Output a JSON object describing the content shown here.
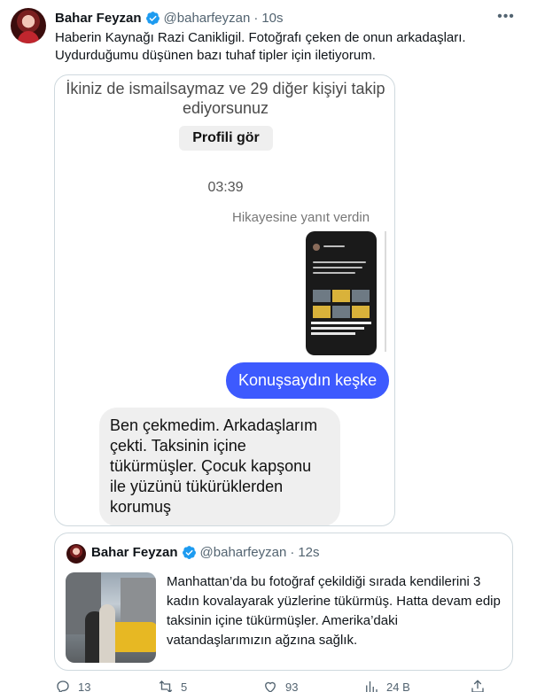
{
  "author": {
    "name": "Bahar Feyzan",
    "handle": "@baharfeyzan",
    "separator": "·",
    "time": "10s"
  },
  "tweet": {
    "text": "Haberin Kaynağı Razi Canikligil. Fotoğrafı çeken de onun arkadaşları. Uydurduğumu düşünen bazı tuhaf tipler için iletiyorum."
  },
  "dm": {
    "follow_notice": "İkiniz de ismailsaymaz ve 29 diğer kişiyi takip ediyorsunuz",
    "profile_button": "Profili gör",
    "time": "03:39",
    "story_reply_label": "Hikayesine yanıt verdin",
    "sent_message": "Konuşsaydın keşke",
    "received_message": "Ben çekmedim. Arkadaşlarım çekti. Taksinin içine tükürmüşler. Çocuk kapşonu ile yüzünü tükürüklerden korumuş"
  },
  "quote": {
    "name": "Bahar Feyzan",
    "handle": "@baharfeyzan",
    "separator": "·",
    "time": "12s",
    "text": "Manhattan’da bu fotoğraf çekildiği sırada kendilerini 3 kadın kovalayarak yüzlerine tükürmüş. Hatta devam edip taksinin içine tükürmüşler. Amerika’daki vatandaşlarımızın ağzına sağlık."
  },
  "actions": {
    "replies": "13",
    "retweets": "5",
    "likes": "93",
    "views": "24 B"
  },
  "colors": {
    "verified": "#1d9bf0",
    "sent_bubble": "#3d5afe",
    "received_bubble": "#efefef",
    "muted_text": "#536471"
  }
}
